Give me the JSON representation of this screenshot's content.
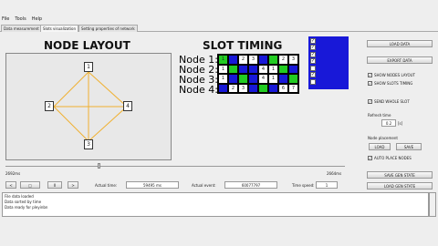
{
  "menu": [
    "File",
    "Tools",
    "Help"
  ],
  "tabs": [
    "Data measurement",
    "Slots visualization",
    "Setting properties of network"
  ],
  "node_layout": {
    "title": "NODE LAYOUT",
    "nodes": [
      "1",
      "2",
      "3",
      "4"
    ]
  },
  "slot_timing": {
    "title": "SLOT TIMING",
    "rows": [
      {
        "label": "Node 1:",
        "cells": [
          {
            "text": "1",
            "state": "tx"
          },
          {
            "text": "",
            "state": "idle"
          },
          {
            "text": "2",
            "state": "rx"
          },
          {
            "text": "3",
            "state": "rx"
          },
          {
            "text": "",
            "state": "idle"
          },
          {
            "text": "",
            "state": "tx"
          },
          {
            "text": "2",
            "state": "rx"
          },
          {
            "text": "3",
            "state": "rx"
          }
        ]
      },
      {
        "label": "Node 2:",
        "cells": [
          {
            "text": "1",
            "state": "rx"
          },
          {
            "text": "",
            "state": "tx"
          },
          {
            "text": "",
            "state": "idle"
          },
          {
            "text": "",
            "state": "idle"
          },
          {
            "text": "4",
            "state": "rx"
          },
          {
            "text": "1",
            "state": "rx"
          },
          {
            "text": "",
            "state": "tx"
          },
          {
            "text": "",
            "state": "idle"
          }
        ]
      },
      {
        "label": "Node 3:",
        "cells": [
          {
            "text": "1",
            "state": "rx"
          },
          {
            "text": "",
            "state": "idle"
          },
          {
            "text": "",
            "state": "tx"
          },
          {
            "text": "",
            "state": "idle"
          },
          {
            "text": "4",
            "state": "rx"
          },
          {
            "text": "1",
            "state": "rx"
          },
          {
            "text": "",
            "state": "idle"
          },
          {
            "text": "",
            "state": "tx"
          }
        ]
      },
      {
        "label": "Node 4:",
        "cells": [
          {
            "text": "",
            "state": "idle"
          },
          {
            "text": "2",
            "state": "rx"
          },
          {
            "text": "3",
            "state": "rx"
          },
          {
            "text": "",
            "state": "idle"
          },
          {
            "text": "",
            "state": "tx"
          },
          {
            "text": "",
            "state": "idle"
          },
          {
            "text": "6",
            "state": "rx"
          },
          {
            "text": "7",
            "state": "rx"
          }
        ]
      }
    ],
    "legend": [
      {
        "checked": true
      },
      {
        "checked": true
      },
      {
        "checked": true
      },
      {
        "checked": true
      },
      {
        "checked": false
      },
      {
        "checked": true
      },
      {
        "checked": false
      }
    ]
  },
  "colors": {
    "tx": "#22cc22",
    "rx": "#ffffff",
    "idle": "#1818d8",
    "edge": "#f0b030"
  },
  "right_panel": {
    "load_data": "LOAD DATA",
    "export_data": "EXPORT DATA",
    "show_nodes_layout": "SHOW NODES LAYOUT",
    "show_slots_timing": "SHOW SLOTS TIMING",
    "send_whole_slot": "SEND WHOLE SLOT",
    "refresh_time_label": "Refresh time",
    "refresh_time_value": "0.2",
    "refresh_time_unit": "[s]",
    "node_placement_label": "Node placement",
    "load": "LOAD",
    "save": "SAVE",
    "auto_place_nodes": "AUTO PLACE NODES",
    "save_gen_state": "SAVE GEN STATE",
    "load_gen_state": "LOAD GEN STATE"
  },
  "timeline": {
    "start_label": "2692ms",
    "end_label": "2664ms"
  },
  "controls": {
    "btn_prev": "<",
    "btn_stop": "□",
    "btn_pause": "II",
    "btn_next": ">",
    "actual_time_label": "Actual time:",
    "actual_time_value": "59495 ms",
    "actual_event_label": "Actual event:",
    "actual_event_value": "60077797",
    "time_speed_label": "Time speed:",
    "time_speed_value": "1"
  },
  "console": [
    "File data loaded",
    "Data sorted by time",
    "Data ready for pleyinbn"
  ]
}
